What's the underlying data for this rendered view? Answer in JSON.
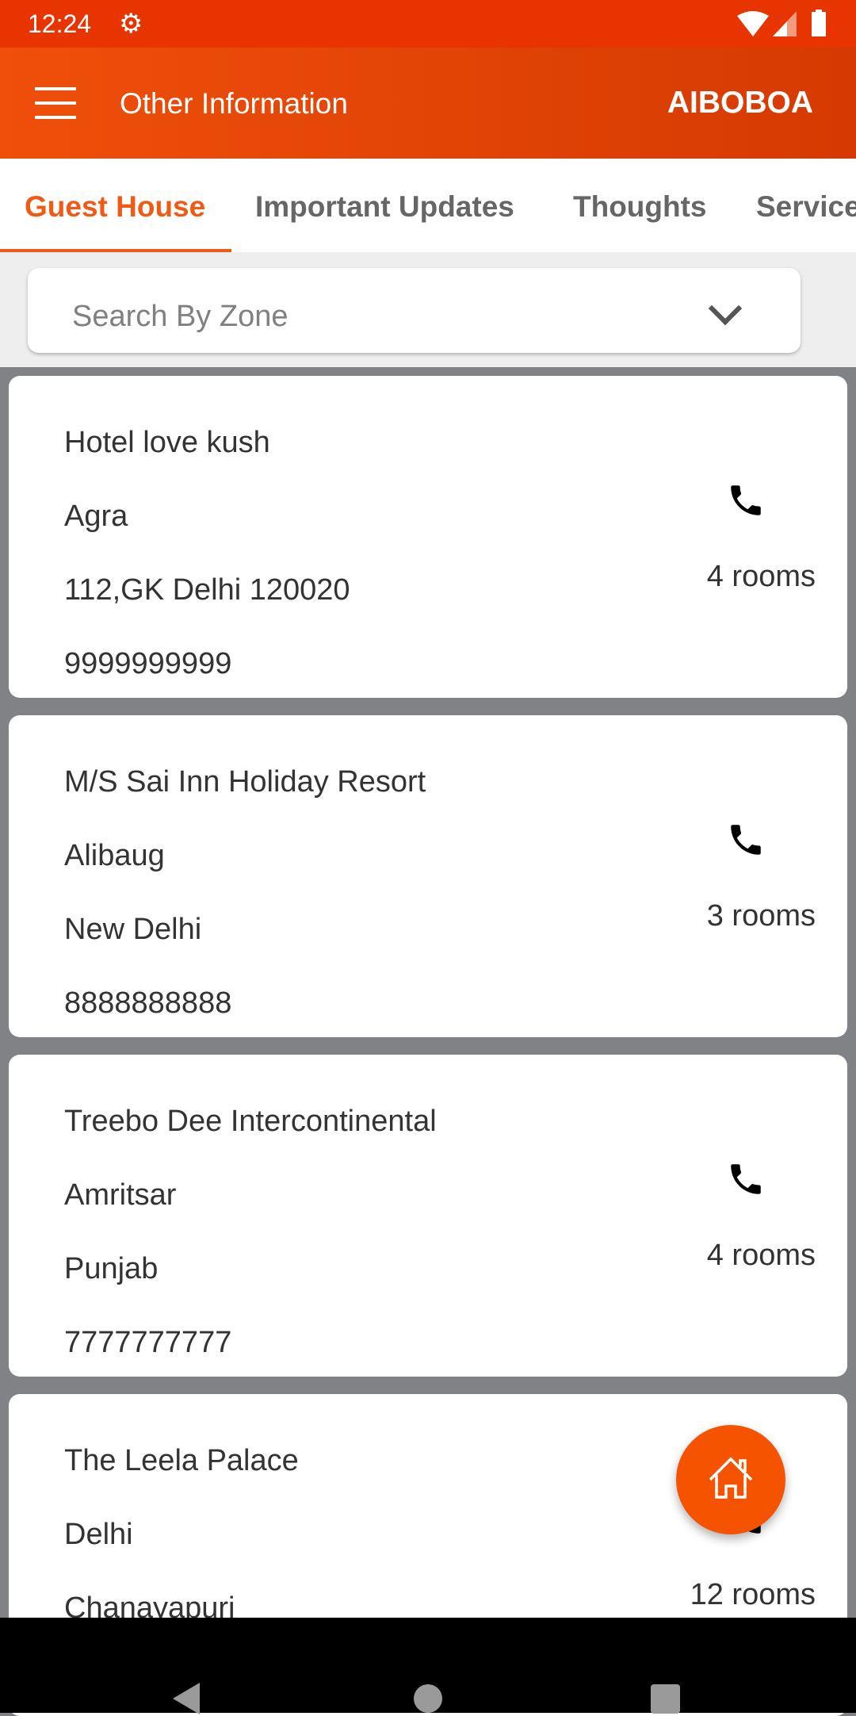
{
  "status_bar": {
    "time": "12:24",
    "icons": [
      "gear-icon",
      "wifi-icon",
      "signal-icon",
      "battery-icon"
    ]
  },
  "app_bar": {
    "title": "Other Information",
    "brand": "AIBOBOA",
    "menu_icon": "hamburger-icon"
  },
  "tabs": [
    {
      "label": "Guest House",
      "active": true
    },
    {
      "label": "Important Updates"
    },
    {
      "label": "Thoughts"
    },
    {
      "label": "Service"
    }
  ],
  "search": {
    "placeholder": "Search By Zone",
    "icon": "chevron-down-icon"
  },
  "cards": [
    {
      "name": "Hotel love kush",
      "city": "Agra",
      "address": "112,GK Delhi 120020",
      "phone": "9999999999",
      "rooms": "4 rooms"
    },
    {
      "name": "M/S Sai Inn Holiday Resort",
      "city": "Alibaug",
      "address": "New Delhi",
      "phone": "8888888888",
      "rooms": "3 rooms"
    },
    {
      "name": "Treebo Dee Intercontinental",
      "city": "Amritsar",
      "address": "Punjab",
      "phone": "7777777777",
      "rooms": "4 rooms"
    },
    {
      "name": "The Leela Palace",
      "city": "Delhi",
      "address": "Chanayapuri",
      "rooms": "12 rooms"
    }
  ],
  "colors": {
    "accent": "#f05a14",
    "appbar": "#e64a0a",
    "fab": "#f65300",
    "background": "#808285"
  }
}
